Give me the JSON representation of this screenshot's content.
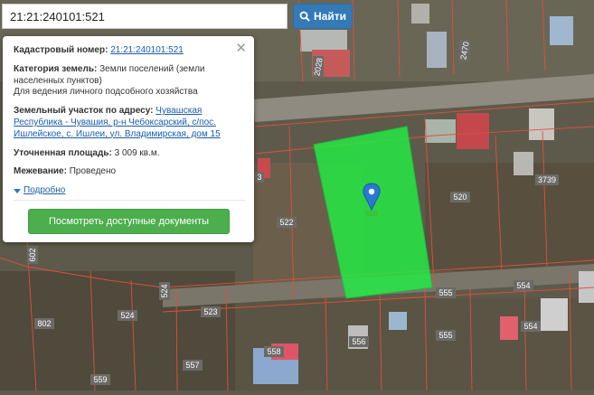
{
  "search": {
    "value": "21:21:240101:521",
    "button_label": "Найти"
  },
  "popup": {
    "cadastral_label": "Кадастровый номер:",
    "cadastral_value": "21:21:240101:521",
    "category_label": "Категория земель:",
    "category_value": "Земли поселений (земли населенных пунктов)",
    "usage": "Для ведения личного подсобного хозяйства",
    "address_label": "Земельный участок по адресу:",
    "address_value": "Чувашская Республика - Чувашия, р-н Чебоксарский, с/пос. Ишлейское, с. Ишлеи, ул. Владимирская, дом 15",
    "area_label": "Уточненная площадь:",
    "area_value": "3 009 кв.м.",
    "survey_label": "Межевание:",
    "survey_value": "Проведено",
    "more_label": "Подробно",
    "docs_button": "Посмотреть доступные документы"
  },
  "map": {
    "parcel_labels": [
      "520",
      "522",
      "523",
      "524",
      "524",
      "555",
      "555",
      "554",
      "554",
      "556",
      "557",
      "558",
      "559",
      "802",
      "3739",
      "2028",
      "2470",
      "602",
      "3"
    ],
    "highlight_color": "#22ee44",
    "boundary_color": "#e0503a"
  }
}
